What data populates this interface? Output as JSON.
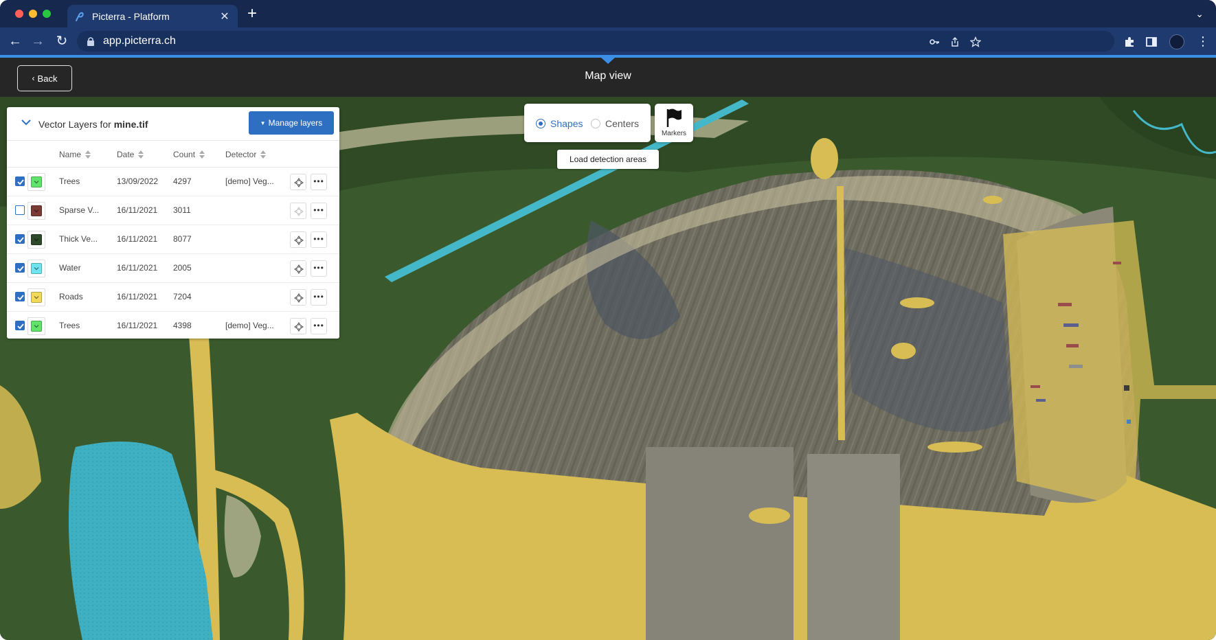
{
  "browser": {
    "tab_title": "Picterra - Platform",
    "url": "app.picterra.ch"
  },
  "header": {
    "back_label": "Back",
    "title": "Map view"
  },
  "panel": {
    "title_prefix": "Vector Layers for ",
    "title_file": "mine.tif",
    "manage_label": "Manage layers",
    "columns": [
      "Name",
      "Date",
      "Count",
      "Detector"
    ],
    "rows": [
      {
        "checked": true,
        "color": "#5fe36a",
        "name": "Trees",
        "date": "13/09/2022",
        "count": "4297",
        "detector": "[demo] Veg...",
        "locate_enabled": true
      },
      {
        "checked": false,
        "color": "#7a3a35",
        "name": "Sparse V...",
        "date": "16/11/2021",
        "count": "3011",
        "detector": "",
        "locate_enabled": false
      },
      {
        "checked": true,
        "color": "#2e4a2a",
        "name": "Thick Ve...",
        "date": "16/11/2021",
        "count": "8077",
        "detector": "",
        "locate_enabled": true
      },
      {
        "checked": true,
        "color": "#6fe3f0",
        "name": "Water",
        "date": "16/11/2021",
        "count": "2005",
        "detector": "",
        "locate_enabled": true
      },
      {
        "checked": true,
        "color": "#f2d95a",
        "name": "Roads",
        "date": "16/11/2021",
        "count": "7204",
        "detector": "",
        "locate_enabled": true
      },
      {
        "checked": true,
        "color": "#5fe36a",
        "name": "Trees",
        "date": "16/11/2021",
        "count": "4398",
        "detector": "[demo] Veg...",
        "locate_enabled": true
      }
    ]
  },
  "map_controls": {
    "mode_shapes": "Shapes",
    "mode_centers": "Centers",
    "selected_mode": "Shapes",
    "markers_label": "Markers",
    "load_label": "Load detection areas"
  },
  "colors": {
    "accent": "#3b8fe7",
    "primary_button": "#2f6fc1",
    "header_bg": "#262626",
    "road_overlay": "#d8bd55",
    "water_overlay": "#44b8c8"
  }
}
